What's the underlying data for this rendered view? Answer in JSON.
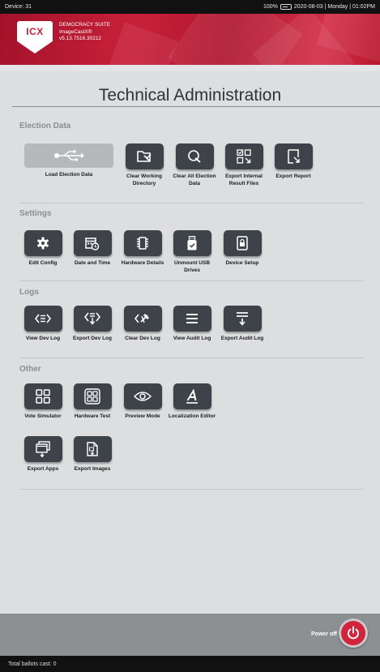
{
  "status_bar": {
    "device": "Device: 31",
    "battery": "100%",
    "datetime": "2020-08-03 | Monday | 01:02PM"
  },
  "brand": {
    "logo": "ICX",
    "suite": "DEMOCRACY SUITE",
    "product": "ImageCastX®",
    "version": "v5.13.7516.30212",
    "color": "#c8203a"
  },
  "page_title": "Technical Administration",
  "sections": {
    "election": {
      "heading": "Election Data",
      "items": [
        {
          "label": "Load Election Data",
          "icon": "usb-icon"
        },
        {
          "label": "Clear Working Directory",
          "icon": "clear-folder-icon"
        },
        {
          "label": "Clear All Election Data",
          "icon": "clear-all-icon"
        },
        {
          "label": "Export Internal Result Files",
          "icon": "export-results-icon"
        },
        {
          "label": "Export Report",
          "icon": "export-report-icon"
        }
      ]
    },
    "settings": {
      "heading": "Settings",
      "items": [
        {
          "label": "Edit Config",
          "icon": "gear-icon"
        },
        {
          "label": "Date and Time",
          "icon": "calendar-clock-icon"
        },
        {
          "label": "Hardware Details",
          "icon": "chip-icon"
        },
        {
          "label": "Unmount USB Drives",
          "icon": "usb-drive-icon"
        },
        {
          "label": "Device Setup",
          "icon": "lock-icon"
        }
      ]
    },
    "logs": {
      "heading": "Logs",
      "items": [
        {
          "label": "View Dev Log",
          "icon": "code-icon"
        },
        {
          "label": "Export Dev Log",
          "icon": "export-code-icon"
        },
        {
          "label": "Clear Dev Log",
          "icon": "clear-code-icon"
        },
        {
          "label": "View Audit Log",
          "icon": "list-icon"
        },
        {
          "label": "Export Audit Log",
          "icon": "export-list-icon"
        }
      ]
    },
    "other": {
      "heading": "Other",
      "items": [
        {
          "label": "Vote Simulator",
          "icon": "grid-icon"
        },
        {
          "label": "Hardware Test",
          "icon": "grid-box-icon"
        },
        {
          "label": "Preview Mode",
          "icon": "eye-icon"
        },
        {
          "label": "Localization Editor",
          "icon": "text-a-icon"
        },
        {
          "label": "Export Apps",
          "icon": "export-apps-icon"
        },
        {
          "label": "Export Images",
          "icon": "export-images-icon"
        }
      ]
    }
  },
  "footer": {
    "power_label": "Power off",
    "power_color": "#d2243c",
    "total_ballots": "Total ballots cast: 0"
  }
}
